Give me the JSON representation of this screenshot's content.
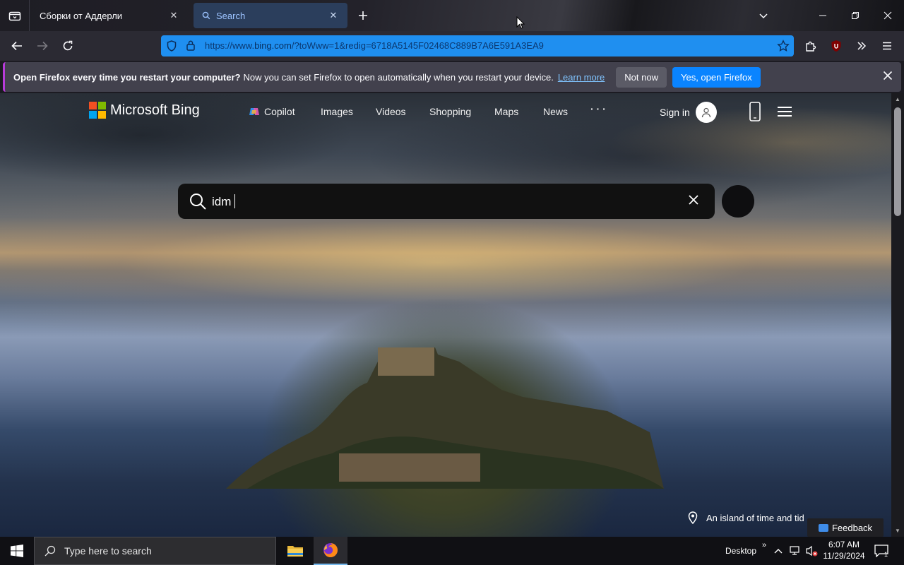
{
  "browser": {
    "tabs": [
      {
        "label": "Сборки от Аддерли",
        "active": false
      },
      {
        "label": "Search",
        "active": true
      }
    ],
    "url": {
      "prefix": "https://www.",
      "domain": "bing.com",
      "path": "/?toWww=1&redig=6718A5145F02468C889B7A6E591A3EA9"
    },
    "extension_badge": "19"
  },
  "notification": {
    "bold_text": "Open Firefox every time you restart your computer?",
    "text": "Now you can set Firefox to open automatically when you restart your device.",
    "link": "Learn more",
    "secondary_button": "Not now",
    "primary_button": "Yes, open Firefox"
  },
  "bing": {
    "logo_text": "Microsoft Bing",
    "nav": [
      "Copilot",
      "Images",
      "Videos",
      "Shopping",
      "Maps",
      "News",
      "· · ·"
    ],
    "sign_in": "Sign in",
    "search_query": "idm",
    "caption": "An island of time and tid",
    "feedback": "Feedback"
  },
  "taskbar": {
    "search_placeholder": "Type here to search",
    "desktop_label": "Desktop",
    "time": "6:07 AM",
    "date": "11/29/2024",
    "notification_count": "1"
  },
  "colors": {
    "accent_blue": "#0a84ff",
    "url_bar": "#1f8ff0",
    "active_tab": "#2b3e5c"
  }
}
